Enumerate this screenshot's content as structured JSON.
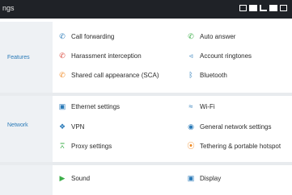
{
  "header": {
    "title": "ngs"
  },
  "sections": [
    {
      "label": "Features",
      "items": [
        {
          "label": "Call forwarding",
          "icon": "call-forward-icon",
          "color": "#2a7ab8"
        },
        {
          "label": "Auto answer",
          "icon": "auto-answer-icon",
          "color": "#3cae49"
        },
        {
          "label": "Harassment interception",
          "icon": "call-block-icon",
          "color": "#d9473b"
        },
        {
          "label": "Account ringtones",
          "icon": "speaker-icon",
          "color": "#2a7ab8"
        },
        {
          "label": "Shared call appearance (SCA)",
          "icon": "shared-call-icon",
          "color": "#f08a24"
        },
        {
          "label": "Bluetooth",
          "icon": "bluetooth-icon",
          "color": "#2a7ab8"
        }
      ]
    },
    {
      "label": "Network",
      "items": [
        {
          "label": "Ethernet settings",
          "icon": "ethernet-icon",
          "color": "#2a7ab8"
        },
        {
          "label": "Wi-Fi",
          "icon": "wifi-icon",
          "color": "#2a7ab8"
        },
        {
          "label": "VPN",
          "icon": "vpn-icon",
          "color": "#2a7ab8"
        },
        {
          "label": "General network settings",
          "icon": "globe-icon",
          "color": "#2a7ab8"
        },
        {
          "label": "Proxy settings",
          "icon": "proxy-icon",
          "color": "#3cae49"
        },
        {
          "label": "Tethering & portable hotspot",
          "icon": "hotspot-icon",
          "color": "#f08a24"
        }
      ]
    },
    {
      "label": "",
      "items": [
        {
          "label": "Sound",
          "icon": "sound-icon",
          "color": "#3cae49"
        },
        {
          "label": "Display",
          "icon": "display-icon",
          "color": "#2a7ab8"
        }
      ]
    }
  ]
}
